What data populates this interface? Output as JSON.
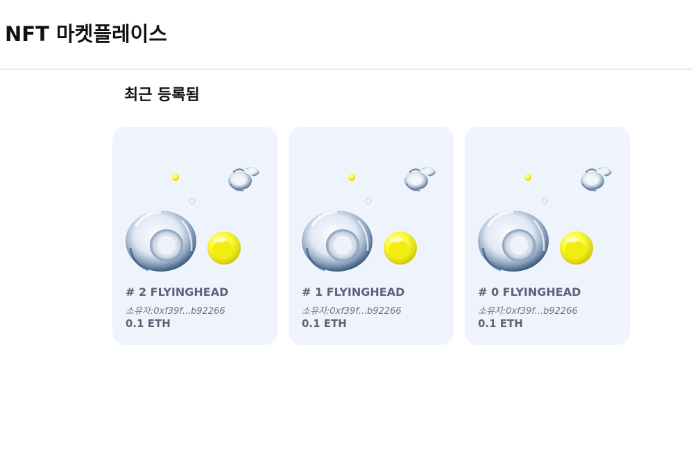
{
  "header": {
    "title": "NFT 마켓플레이스"
  },
  "main": {
    "section_title": "최근 등록됨",
    "cards": [
      {
        "name": "# 2 FLYINGHEAD",
        "owner": "소유자:0xf39f...b92266",
        "price": "0.1 ETH",
        "image_icon": "glass-shapes-art-icon"
      },
      {
        "name": "# 1 FLYINGHEAD",
        "owner": "소유자:0xf39f...b92266",
        "price": "0.1 ETH",
        "image_icon": "glass-shapes-art-icon"
      },
      {
        "name": "# 0 FLYINGHEAD",
        "owner": "소유자:0xf39f...b92266",
        "price": "0.1 ETH",
        "image_icon": "glass-shapes-art-icon"
      }
    ]
  },
  "colors": {
    "card_background": "#eff4fc",
    "card_text": "#5b6478",
    "accent_yellow": "#f4f020"
  }
}
